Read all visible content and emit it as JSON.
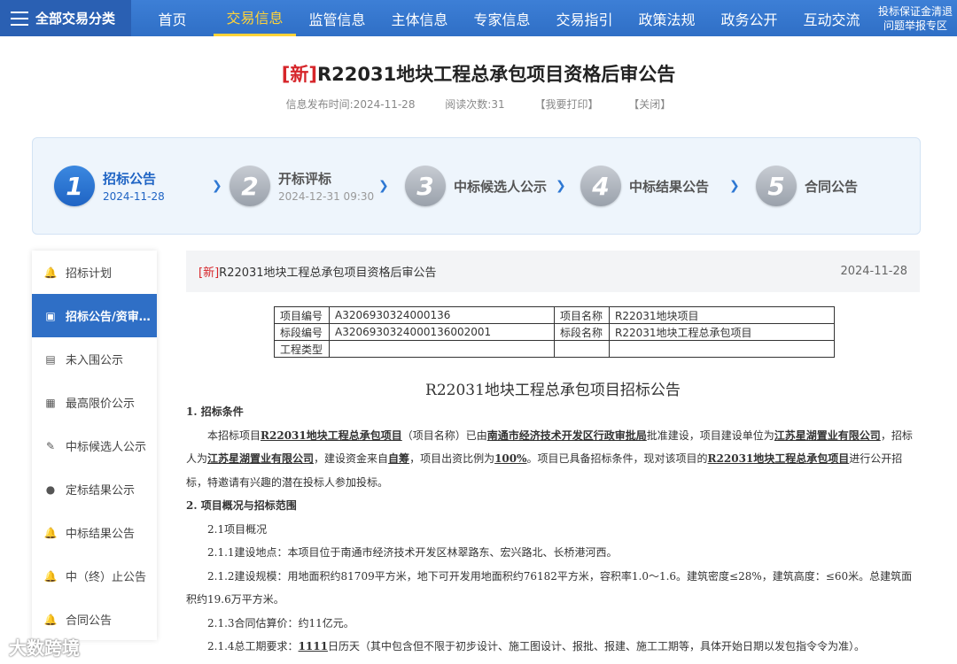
{
  "nav": {
    "all_label": "全部交易分类",
    "items": [
      "首页",
      "交易信息",
      "监管信息",
      "主体信息",
      "专家信息",
      "交易指引",
      "政策法规",
      "政务公开",
      "互动交流"
    ],
    "special_line1": "投标保证金清退",
    "special_line2": "问题举报专区",
    "active_color": "#ffd338"
  },
  "title": {
    "tag": "[新]",
    "text": "R22031地块工程总承包项目资格后审公告"
  },
  "meta": {
    "published": "信息发布时间:2024-11-28",
    "reads": "阅读次数:31",
    "print": "【我要打印】",
    "close": "【关闭】"
  },
  "steps": [
    {
      "num": "1",
      "label": "招标公告",
      "date": "2024-11-28"
    },
    {
      "num": "2",
      "label": "开标评标",
      "date": "2024-12-31 09:30"
    },
    {
      "num": "3",
      "label": "中标候选人公示",
      "date": ""
    },
    {
      "num": "4",
      "label": "中标结果公告",
      "date": ""
    },
    {
      "num": "5",
      "label": "合同公告",
      "date": ""
    }
  ],
  "sidebar": [
    {
      "label": "招标计划",
      "icon": "bell-icon"
    },
    {
      "label": "招标公告/资审…",
      "icon": "document-icon"
    },
    {
      "label": "未入围公示",
      "icon": "briefcase-icon"
    },
    {
      "label": "最高限价公示",
      "icon": "money-icon"
    },
    {
      "label": "中标候选人公示",
      "icon": "edit-icon"
    },
    {
      "label": "定标结果公示",
      "icon": "user-icon"
    },
    {
      "label": "中标结果公告",
      "icon": "bell-icon"
    },
    {
      "label": "中（终）止公告",
      "icon": "bell-icon"
    },
    {
      "label": "合同公告",
      "icon": "bell-icon"
    }
  ],
  "content_head": {
    "tag": "[新]",
    "text": "R22031地块工程总承包项目资格后审公告",
    "date": "2024-11-28"
  },
  "table": {
    "r1": [
      "项目编号",
      "A3206930324000136",
      "项目名称",
      "R22031地块项目"
    ],
    "r2": [
      "标段编号",
      "A3206930324000136002001",
      "标段名称",
      "R22031地块工程总承包项目"
    ],
    "r3": [
      "工程类型",
      "",
      "",
      ""
    ]
  },
  "doc_title": "R22031地块工程总承包项目招标公告",
  "body": {
    "h1": "1. 招标条件",
    "p1_a": "本招标项目",
    "p1_b": "R22031地块工程总承包项目",
    "p1_c": "（项目名称）已由",
    "p1_d": "南通市经济技术开发区行政审批局",
    "p1_e": "批准建设，项目建设单位为",
    "p1_f": "江苏星湖置业有限公司",
    "p1_g": "，招标人为",
    "p1_h": "江苏星湖置业有限公司",
    "p1_i": "，建设资金来自",
    "p1_j": "自筹",
    "p1_k": "，项目出资比例为",
    "p1_l": "100%",
    "p1_m": "。项目已具备招标条件，现对该项目的",
    "p1_n": "R22031地块工程总承包项目",
    "p1_o": "进行公开招标，特邀请有兴趣的潜在投标人参加投标。",
    "h2": "2. 项目概况与招标范围",
    "s21": "2.1项目概况",
    "s211": "2.1.1建设地点：本项目位于南通市经济技术开发区林翠路东、宏兴路北、长桥港河西。",
    "s212": "2.1.2建设规模：用地面积约81709平方米，地下可开发用地面积约76182平方米，容积率1.0～1.6。建筑密度≤28%，建筑高度：≤60米。总建筑面积约19.6万平方米。",
    "s213": "2.1.3合同估算价：约11亿元。",
    "s214_a": "2.1.4总工期要求：",
    "s214_b": "1111",
    "s214_c": "日历天（其中包含但不限于初步设计、施工图设计、报批、报建、施工工期等，具体开始日期以发包指令令为准）。"
  },
  "watermark": "大数跨境"
}
